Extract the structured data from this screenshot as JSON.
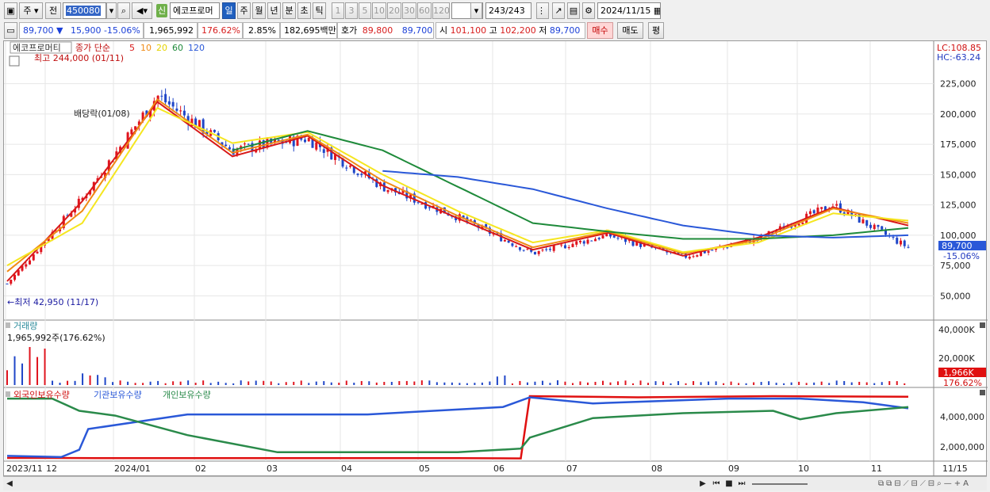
{
  "toolbar": {
    "market_type": "주",
    "scope": "전",
    "code": "450080",
    "search_glyph": "🔍",
    "stock_name": "에코프로머",
    "new_tag": "신",
    "periods": [
      "일",
      "주",
      "월",
      "년",
      "분",
      "초",
      "틱"
    ],
    "active_period": "일",
    "intervals": [
      "1",
      "3",
      "5",
      "10",
      "20",
      "30",
      "60",
      "120"
    ],
    "count": "243",
    "count_total": "/243",
    "date": "2024/11/15"
  },
  "quote": {
    "price": "89,700",
    "change": "15,900",
    "change_pct": "-15.06%",
    "volume": "1,965,992",
    "volume_ratio": "176.62%",
    "turnover": "2.85%",
    "amount": "182,695백만",
    "bid_label": "호가",
    "ask": "89,800",
    "bid": "89,700",
    "open_label": "시",
    "open": "101,100",
    "high_label": "고",
    "high": "102,200",
    "low_label": "저",
    "low": "89,700",
    "buy_label": "매수",
    "sell_label": "매도",
    "eval_label": "평"
  },
  "price_panel": {
    "stock_tag": "에코프로머티",
    "legend_title": "종가 단순",
    "ma_periods": [
      "5",
      "10",
      "20",
      "60",
      "120"
    ],
    "high_note": "최고 244,000 (01/11)",
    "low_note": "←최저 42,950 (11/17)",
    "annotation": "배당락(01/08)",
    "lc": "LC:108.85",
    "hc": "HC:-63.24",
    "y_ticks": [
      "225,000",
      "200,000",
      "175,000",
      "150,000",
      "125,000",
      "100,000",
      "75,000",
      "50,000"
    ],
    "last_price": "89,700",
    "last_pct": "-15.06%"
  },
  "volume_panel": {
    "title": "거래량",
    "value": "1,965,992주(176.62%)",
    "y_ticks": [
      "40,000K",
      "20,000K"
    ],
    "last": "1,966K",
    "last_pct": "176.62%"
  },
  "holding_panel": {
    "legend": [
      "외국인보유수량",
      "기관보유수량",
      "개인보유수량"
    ],
    "y_ticks": [
      "4,000,000",
      "2,000,000"
    ]
  },
  "x_axis": {
    "labels": [
      "2023/11",
      "12",
      "2024/01",
      "02",
      "03",
      "04",
      "05",
      "06",
      "07",
      "08",
      "09",
      "10",
      "11",
      "11/15"
    ]
  },
  "colors": {
    "up": "#e0141e",
    "down": "#1f46c8",
    "ma5": "#d81818",
    "ma10": "#f08a14",
    "ma20": "#f5e620",
    "ma60": "#1e8a3a",
    "ma120": "#2a58d8",
    "foreign": "#e01010",
    "institution": "#2a58d8",
    "individual": "#2a8a4a"
  },
  "chart_data": {
    "type": "line",
    "x": [
      "2023/11",
      "12",
      "2024/01",
      "02",
      "03",
      "04",
      "05",
      "06",
      "07",
      "08",
      "09",
      "10",
      "11"
    ],
    "series": [
      {
        "name": "종가",
        "values": [
          60000,
          130000,
          215000,
          170000,
          180000,
          140000,
          115000,
          85000,
          100000,
          82000,
          97000,
          125000,
          89700
        ]
      },
      {
        "name": "5",
        "values": [
          62000,
          128000,
          210000,
          165000,
          182000,
          141000,
          114000,
          88000,
          102000,
          83000,
          98000,
          123000,
          108000
        ]
      },
      {
        "name": "10",
        "values": [
          70000,
          120000,
          212000,
          168000,
          183000,
          145000,
          116000,
          90000,
          103000,
          85000,
          96000,
          122000,
          110000
        ]
      },
      {
        "name": "20",
        "values": [
          75000,
          110000,
          205000,
          176000,
          185000,
          150000,
          120000,
          94000,
          104000,
          86000,
          94000,
          118000,
          112000
        ]
      },
      {
        "name": "60",
        "values": [
          null,
          null,
          null,
          170000,
          186000,
          170000,
          140000,
          110000,
          103000,
          97000,
          97000,
          100000,
          106000
        ]
      },
      {
        "name": "120",
        "values": [
          null,
          null,
          null,
          null,
          null,
          153000,
          148000,
          138000,
          122000,
          108000,
          100000,
          98000,
          100000
        ]
      }
    ],
    "ylim": [
      30000,
      260000
    ]
  }
}
